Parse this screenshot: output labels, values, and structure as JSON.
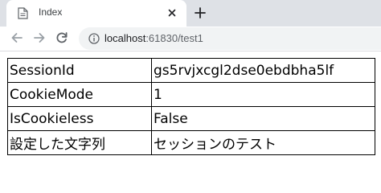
{
  "tab": {
    "title": "Index",
    "favicon": "document-icon",
    "close_icon": "close-icon"
  },
  "new_tab_icon": "plus-icon",
  "nav": {
    "back_icon": "back-arrow-icon",
    "forward_icon": "forward-arrow-icon",
    "reload_icon": "reload-icon"
  },
  "address_bar": {
    "icon": "info-icon",
    "host": "localhost",
    "path": ":61830/test1"
  },
  "table": {
    "rows": [
      {
        "key": "SessionId",
        "value": "gs5rvjxcgl2dse0ebdbha5lf"
      },
      {
        "key": "CookieMode",
        "value": "1"
      },
      {
        "key": "IsCookieless",
        "value": "False"
      },
      {
        "key": "設定した文字列",
        "value": "セッションのテスト"
      }
    ]
  },
  "colors": {
    "tab_strip": "#dee1e6",
    "omnibox": "#f1f3f4",
    "icon": "#5f6368"
  }
}
